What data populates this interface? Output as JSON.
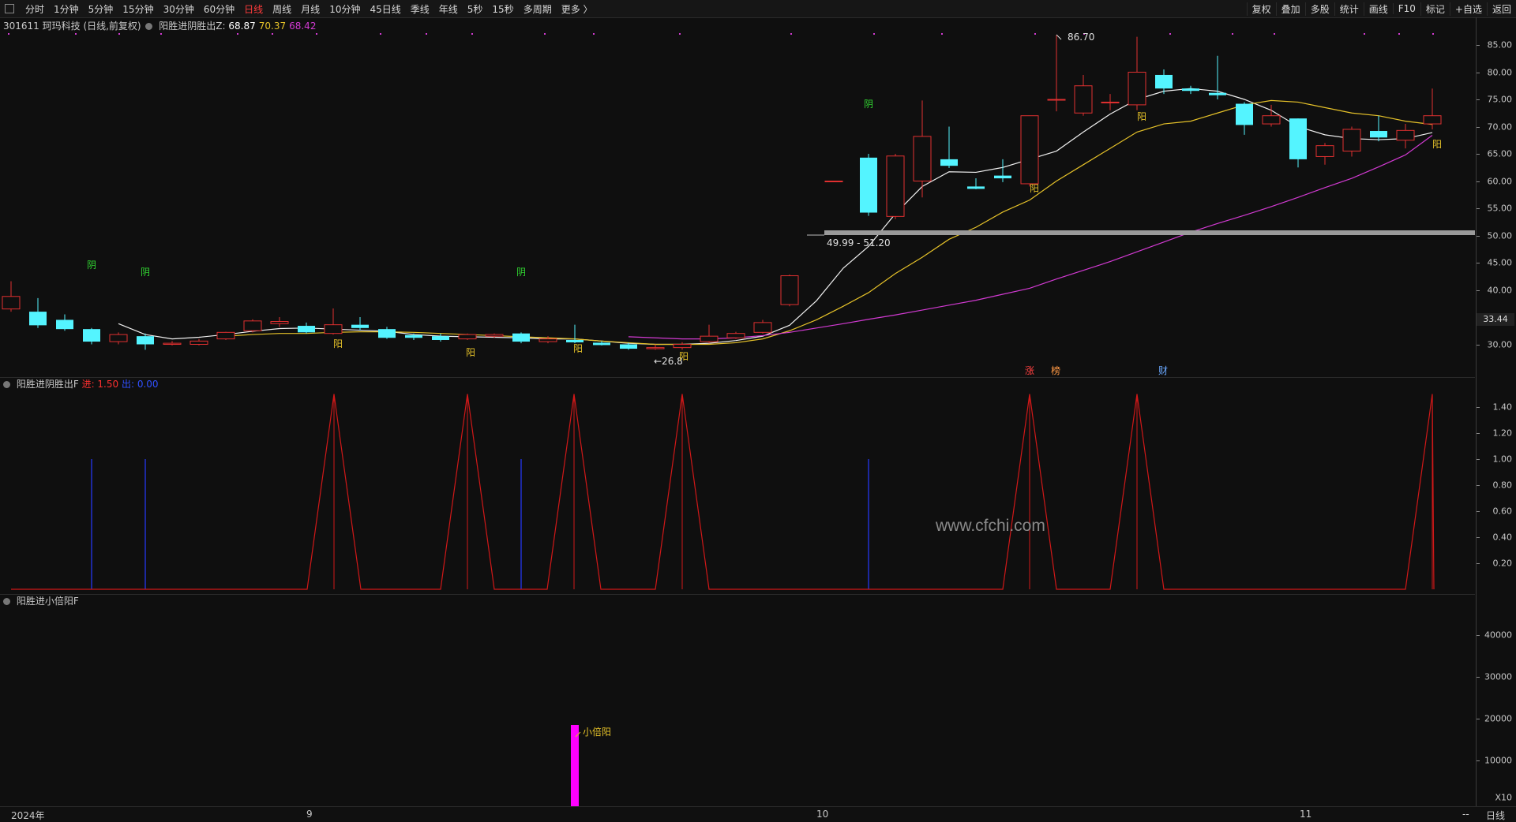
{
  "toolbar": {
    "tabs": [
      "分时",
      "1分钟",
      "5分钟",
      "15分钟",
      "30分钟",
      "60分钟",
      "日线",
      "周线",
      "月线",
      "10分钟",
      "45日线",
      "季线",
      "年线",
      "5秒",
      "15秒",
      "多周期",
      "更多 〉"
    ],
    "active_tab": "日线",
    "right_buttons": [
      "复权",
      "叠加",
      "多股",
      "统计",
      "画线",
      "F10",
      "标记",
      "+自选",
      "返回"
    ]
  },
  "main_panel": {
    "code_name": "301611 珂玛科技 (日线,前复权)",
    "indicator_name": "阳胜进阴胜出Z",
    "indicator_values": [
      {
        "text": "68.87",
        "color": "#ffffff"
      },
      {
        "text": "70.37",
        "color": "#e6c229"
      },
      {
        "text": "68.42",
        "color": "#d23ad2"
      }
    ],
    "y_ticks": [
      "85.00",
      "80.00",
      "75.00",
      "70.00",
      "65.00",
      "60.00",
      "55.00",
      "50.00",
      "45.00",
      "40.00",
      "35.00",
      "30.00"
    ],
    "current_price": "33.44",
    "annotations": {
      "high": "86.70",
      "low": "←26.8",
      "band": "49.99 - 51.20",
      "yin_labels": [
        "阴",
        "阴",
        "阴",
        "阴"
      ],
      "yang_labels": [
        "阳",
        "阳",
        "阳",
        "阳",
        "阳",
        "阳",
        "阳"
      ],
      "events": [
        "涨",
        "榜",
        "财"
      ]
    }
  },
  "panel2": {
    "title": "阳胜进阴胜出F",
    "in_label": "进: 1.50",
    "out_label": "出: 0.00",
    "y_ticks": [
      "1.40",
      "1.20",
      "1.00",
      "0.80",
      "0.60",
      "0.40",
      "0.20"
    ],
    "watermark": "www.cfchi.com"
  },
  "panel3": {
    "title": "阳胜进小倍阳F",
    "y_ticks": [
      "40000",
      "30000",
      "20000",
      "10000"
    ],
    "bar_label": "小倍阳",
    "scale_label": "X10"
  },
  "bottom": {
    "dates": [
      "2024年",
      "9",
      "10",
      "11"
    ],
    "period": "日线",
    "dash": "--"
  },
  "colors": {
    "up": "#e03030",
    "down": "#54f4ff",
    "ma_white": "#f0f0f0",
    "ma_yellow": "#e6c229",
    "ma_purple": "#d23ad2",
    "signal_red": "#d01818",
    "signal_blue": "#2030d0",
    "magenta": "#ff00ff"
  }
}
